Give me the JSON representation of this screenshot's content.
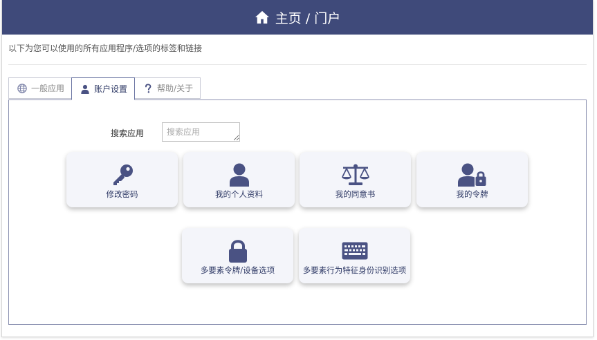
{
  "header": {
    "title": "主页 / 门户",
    "icon": "home-icon"
  },
  "subtitle": "以下为您可以使用的所有应用程序/选项的标签和链接",
  "tabs": [
    {
      "label": "一般应用",
      "icon": "globe-icon",
      "active": false
    },
    {
      "label": "账户设置",
      "icon": "user-icon",
      "active": true
    },
    {
      "label": "帮助/关于",
      "icon": "question-icon",
      "active": false
    }
  ],
  "search": {
    "label": "搜索应用",
    "placeholder": "搜索应用",
    "value": ""
  },
  "apps": [
    {
      "label": "修改密码",
      "icon": "key-icon"
    },
    {
      "label": "我的个人资料",
      "icon": "user-icon"
    },
    {
      "label": "我的同意书",
      "icon": "balance-scale-icon"
    },
    {
      "label": "我的令牌",
      "icon": "user-lock-icon"
    },
    {
      "label": "多要素令牌/设备选项",
      "icon": "lock-icon"
    },
    {
      "label": "多要素行为特征身份识别选项",
      "icon": "keyboard-icon"
    }
  ],
  "colors": {
    "header_bg": "#3f4a7a",
    "icon": "#4a5283",
    "card_bg": "#f4f5fa"
  }
}
